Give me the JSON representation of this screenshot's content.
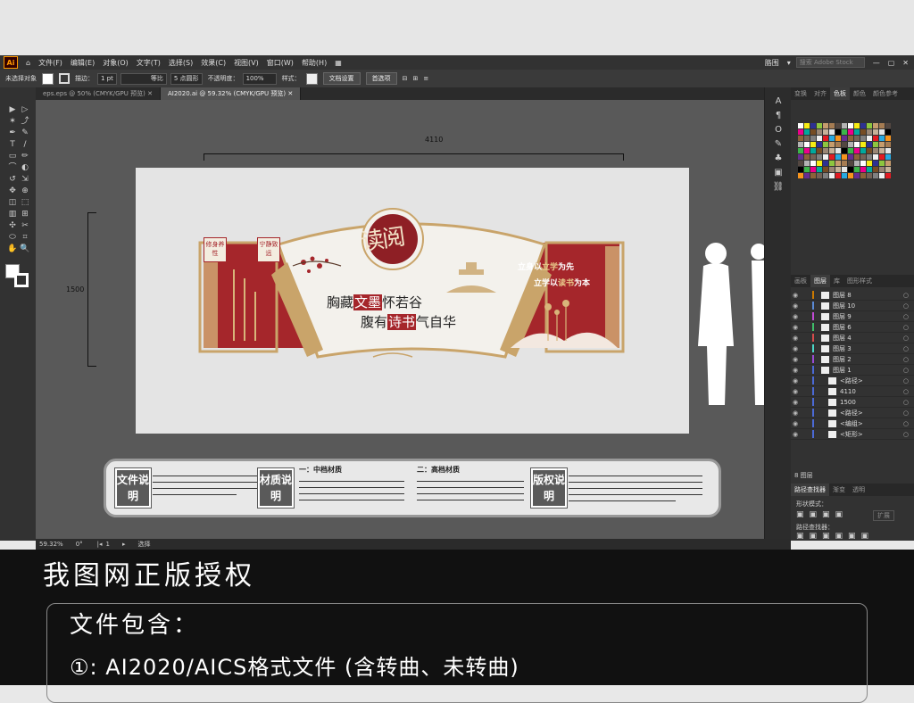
{
  "menubar": {
    "logo": "Ai",
    "items": [
      "文件(F)",
      "编辑(E)",
      "对象(O)",
      "文字(T)",
      "选择(S)",
      "效果(C)",
      "视图(V)",
      "窗口(W)",
      "帮助(H)"
    ],
    "workspace": "胳围",
    "search_placeholder": "搜索 Adobe Stock"
  },
  "controlbar": {
    "selection": "未选择对象",
    "stroke_label": "描边：",
    "stroke_value": "1 pt",
    "profile": "等比",
    "brush": "5 点圆形",
    "opacity_label": "不透明度：",
    "opacity_value": "100%",
    "style_label": "样式：",
    "doc_setup": "文档设置",
    "preferences": "首选项"
  },
  "tabs": [
    {
      "label": "eps.eps @ 50% (CMYK/GPU 预览)",
      "active": false
    },
    {
      "label": "AI2020.ai @ 59.32% (CMYK/GPU 预览)",
      "active": true
    }
  ],
  "canvas": {
    "dim_width": "4110",
    "dim_height": "1500"
  },
  "design": {
    "seal": "读阅",
    "tag1": "修身养性",
    "tag2": "宁静致远",
    "line1_pre": "胸藏",
    "line1_hl": "文墨",
    "line1_post": "怀若谷",
    "line2_pre": "腹有",
    "line2_hl": "诗书",
    "line2_post": "气自华",
    "right1_pre": "立身以",
    "right1_hl": "立学",
    "right1_post": "为先",
    "right2_pre": "立学以",
    "right2_hl": "读书",
    "right2_post": "为本"
  },
  "info": {
    "badge1": "文件说明",
    "badge2": "材质说明",
    "badge3": "版权说明",
    "mid_head": "一：中档材质",
    "high_head": "二：高档材质"
  },
  "rightpanel": {
    "top_tabs": [
      "变换",
      "对齐",
      "色板",
      "颜色",
      "颜色参考"
    ],
    "layer_tabs": [
      "画板",
      "图层",
      "库",
      "图形样式"
    ],
    "layers": [
      {
        "name": "图层 8"
      },
      {
        "name": "图层 10"
      },
      {
        "name": "图层 9"
      },
      {
        "name": "图层 6"
      },
      {
        "name": "图层 4"
      },
      {
        "name": "图层 3"
      },
      {
        "name": "图层 2"
      },
      {
        "name": "图层 1"
      },
      {
        "name": "<路径>"
      },
      {
        "name": "4110"
      },
      {
        "name": "1500"
      },
      {
        "name": "<路径>"
      },
      {
        "name": "<编组>"
      },
      {
        "name": "<矩形>"
      }
    ],
    "layers_count": "8 图层",
    "pathfinder_tabs": [
      "路径查找器",
      "渐变",
      "透明"
    ],
    "shape_modes": "形状模式：",
    "pathfinder_label": "路径查找器：",
    "expand": "扩展"
  },
  "statusbar": {
    "zoom": "59.32%",
    "angle": "0°",
    "artboard": "1",
    "tool": "选择"
  },
  "footer": {
    "auth": "我图网正版授权",
    "contents_heading": "文件包含：",
    "contents_line": "①: AI2020/AICS格式文件 (含转曲、未转曲)"
  }
}
